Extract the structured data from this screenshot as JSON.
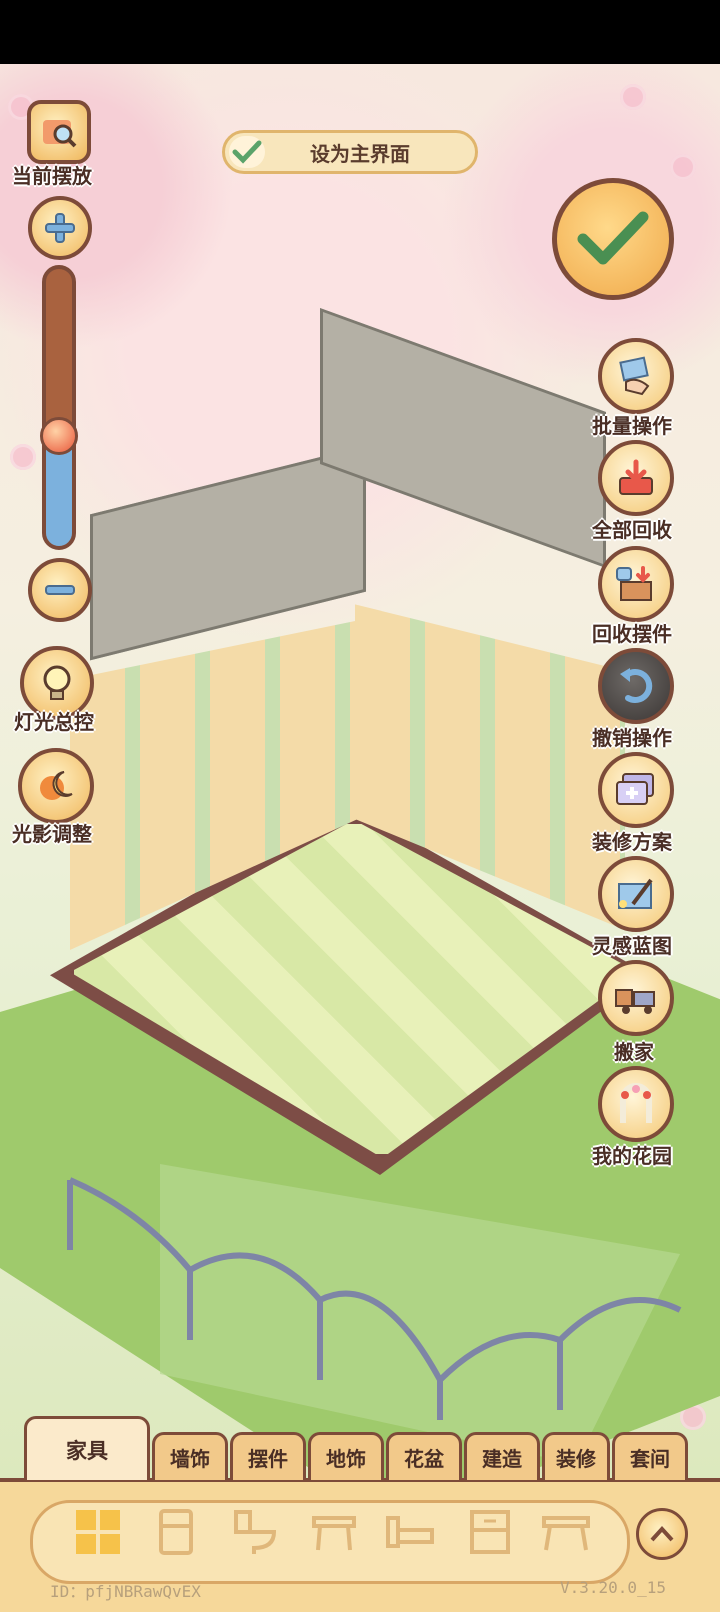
{
  "top_bar": {
    "set_main_label": "设为主界面"
  },
  "left_panel": {
    "current_placement_label": "当前摆放",
    "light_control_label": "灯光总控",
    "shadow_adjust_label": "光影调整",
    "zoom_level": 0.4
  },
  "right_panel": {
    "items": [
      {
        "label": "批量操作",
        "icon": "hand-cards-icon"
      },
      {
        "label": "全部回收",
        "icon": "recycle-tray-icon"
      },
      {
        "label": "回收摆件",
        "icon": "box-arrow-icon"
      },
      {
        "label": "撤销操作",
        "icon": "undo-icon"
      },
      {
        "label": "装修方案",
        "icon": "plan-cards-icon"
      },
      {
        "label": "灵感蓝图",
        "icon": "blueprint-icon"
      },
      {
        "label": "搬家",
        "icon": "truck-icon"
      },
      {
        "label": "我的花园",
        "icon": "garden-arch-icon"
      }
    ]
  },
  "tabs": [
    {
      "label": "家具",
      "active": true
    },
    {
      "label": "墙饰"
    },
    {
      "label": "摆件"
    },
    {
      "label": "地饰"
    },
    {
      "label": "花盆"
    },
    {
      "label": "建造"
    },
    {
      "label": "装修"
    },
    {
      "label": "套间"
    }
  ],
  "categories": [
    "grid-icon",
    "fridge-icon",
    "toilet-icon",
    "table-icon",
    "bed-icon",
    "cabinet-icon",
    "desk-icon"
  ],
  "footer": {
    "id_text": "ID：pfjNBRawQvEX",
    "version_text": "V.3.20.0_15"
  },
  "colors": {
    "accent": "#f0b75c",
    "outline": "#7d4b39",
    "text": "#4a2e25"
  }
}
